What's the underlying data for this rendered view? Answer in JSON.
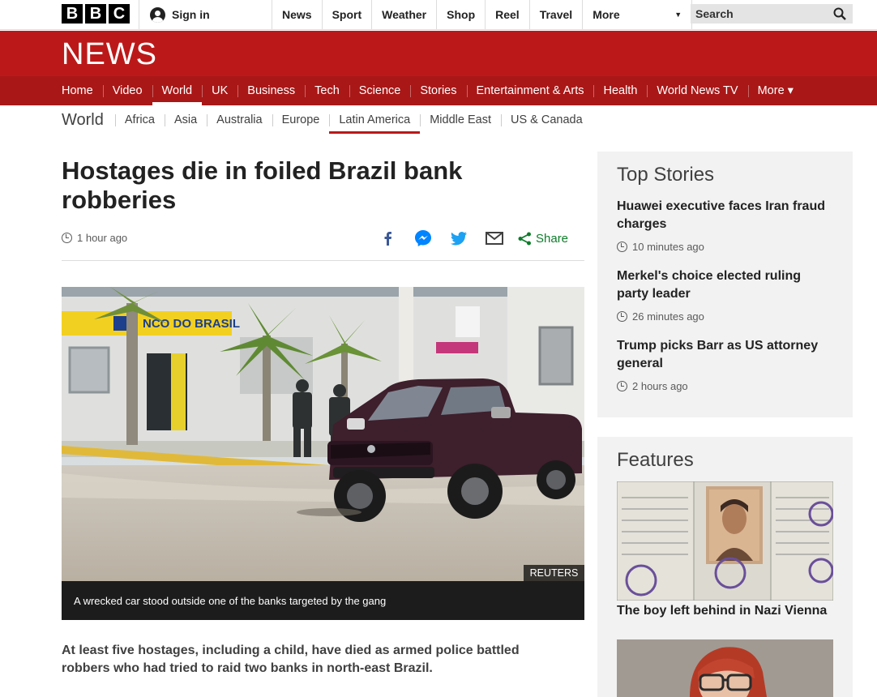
{
  "header": {
    "logo_letters": [
      "B",
      "B",
      "C"
    ],
    "signin_label": "Sign in",
    "nav": [
      "News",
      "Sport",
      "Weather",
      "Shop",
      "Reel",
      "Travel"
    ],
    "more_label": "More",
    "search_placeholder": "Search"
  },
  "banner": {
    "title": "NEWS",
    "color": "#bb1919"
  },
  "main_nav": {
    "items": [
      "Home",
      "Video",
      "World",
      "UK",
      "Business",
      "Tech",
      "Science",
      "Stories",
      "Entertainment & Arts",
      "Health",
      "World News TV",
      "More ▾"
    ],
    "active": "World"
  },
  "section_nav": {
    "section": "World",
    "items": [
      "Africa",
      "Asia",
      "Australia",
      "Europe",
      "Latin America",
      "Middle East",
      "US & Canada"
    ],
    "active": "Latin America"
  },
  "article": {
    "headline": "Hostages die in foiled Brazil bank robberies",
    "timestamp": "1 hour ago",
    "share_label": "Share",
    "share_icons": [
      "facebook-icon",
      "messenger-icon",
      "twitter-icon",
      "email-icon",
      "share-icon"
    ],
    "image_sign": "NCO DO BRASIL",
    "image_credit": "REUTERS",
    "image_caption": "A wrecked car stood outside one of the banks targeted by the gang",
    "intro": "At least five hostages, including a child, have died as armed police battled robbers who had tried to raid two banks in north-east Brazil."
  },
  "top_stories": {
    "title": "Top Stories",
    "items": [
      {
        "title": "Huawei executive faces Iran fraud charges",
        "time": "10 minutes ago"
      },
      {
        "title": "Merkel's choice elected ruling party leader",
        "time": "26 minutes ago"
      },
      {
        "title": "Trump picks Barr as US attorney general",
        "time": "2 hours ago"
      }
    ]
  },
  "features": {
    "title": "Features",
    "items": [
      {
        "title": "The boy left behind in Nazi Vienna"
      }
    ]
  },
  "colors": {
    "accent": "#bb1919",
    "share_green": "#0e7d2b",
    "panel_bg": "#f2f2f2"
  }
}
